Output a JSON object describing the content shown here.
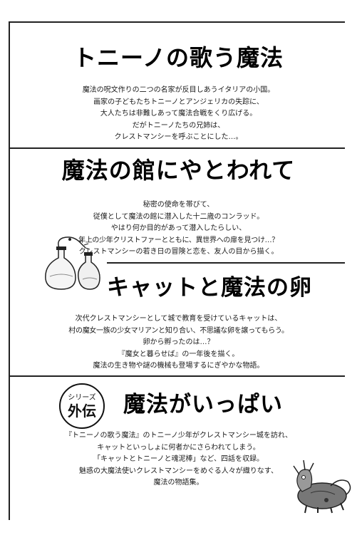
{
  "sections": [
    {
      "title": "トニーノの歌う魔法",
      "lines": [
        "魔法の呪文作りの二つの名家が反目しあうイタリアの小国。",
        "画家の子どもたちトニーノとアンジェリカの失踪に、",
        "大人たちは非難しあって魔法合戦をくり広げる。",
        "だがトニーノたちの兄姉は、",
        "クレストマンシーを呼ぶことにした…。"
      ]
    },
    {
      "title": "魔法の館にやとわれて",
      "lines": [
        "秘密の使命を帯びて、",
        "従僕として魔法の館に潜入した十二歳のコンラッド。",
        "やはり何か目的があって潜入したらしい、",
        "年上の少年クリストファーとともに、異世界への扉を見つけ…？",
        "クレストマンシーの若き日の冒険と恋を、友人の目から描く。"
      ]
    },
    {
      "title": "キャットと魔法の卵",
      "lines": [
        "次代クレストマンシーとして城で教育を受けているキャットは、",
        "村の魔女一族の少女マリアンと知り合い、不思議な卵を譲ってもらう。",
        "卵から孵ったのは…？",
        "『魔女と暮らせば』の一年後を描く。",
        "魔法の生き物や謎の機械も登場するにぎやかな物語。"
      ]
    },
    {
      "title": "魔法がいっぱい",
      "badge_top": "シリーズ",
      "badge_main": "外伝",
      "lines": [
        "『トニーノの歌う魔法』のトニーノ少年がクレストマンシー城を訪れ、",
        "キャットといっしょに何者かにさらわれてしまう。",
        "「キャットとトニーノと魂泥棒」など、四話を収録。",
        "魅惑の大魔法使いクレストマンシーをめぐる人々が織りなす、",
        "魔法の物語集。"
      ]
    }
  ]
}
